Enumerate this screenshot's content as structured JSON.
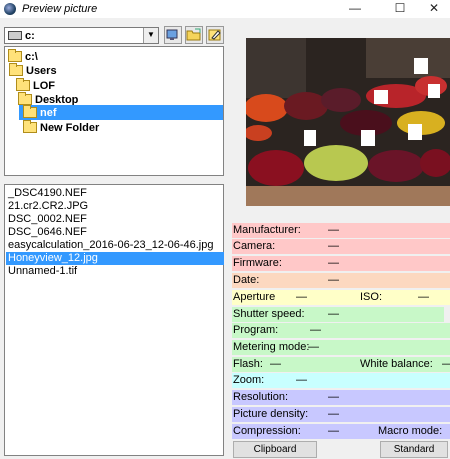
{
  "window": {
    "title": "Preview picture",
    "minimize": "—",
    "maximize": "☐",
    "close": "✕"
  },
  "drive": {
    "value": "c:"
  },
  "folders": [
    {
      "label": "c:\\"
    },
    {
      "label": "Users"
    },
    {
      "label": "LOF"
    },
    {
      "label": "Desktop"
    },
    {
      "label": "nef"
    },
    {
      "label": "New Folder"
    }
  ],
  "files": [
    {
      "name": "_DSC4190.NEF"
    },
    {
      "name": "21.cr2.CR2.JPG"
    },
    {
      "name": "DSC_0002.NEF"
    },
    {
      "name": "DSC_0646.NEF"
    },
    {
      "name": "easycalculation_2016-06-23_12-06-46.jpg"
    },
    {
      "name": "Honeyview_12.jpg"
    },
    {
      "name": "Unnamed-1.tif"
    }
  ],
  "info": {
    "manufacturer": {
      "label": "Manufacturer:",
      "value": "—"
    },
    "camera": {
      "label": "Camera:",
      "value": "—"
    },
    "firmware": {
      "label": "Firmware:",
      "value": "—"
    },
    "date": {
      "label": "Date:",
      "value": "—"
    },
    "aperture": {
      "label": "Aperture",
      "value": "—"
    },
    "iso": {
      "label": "ISO:",
      "value": "—"
    },
    "shutter": {
      "label": "Shutter speed:",
      "value": "—"
    },
    "program": {
      "label": "Program:",
      "value": "—"
    },
    "metering": {
      "label": "Metering mode:",
      "value": "—"
    },
    "flash": {
      "label": "Flash:",
      "value": "—"
    },
    "white_balance": {
      "label": "White balance:",
      "value": "—"
    },
    "zoom": {
      "label": "Zoom:",
      "value": "—"
    },
    "resolution": {
      "label": "Resolution:",
      "value": "—"
    },
    "density": {
      "label": "Picture density:",
      "value": "—"
    },
    "compression": {
      "label": "Compression:",
      "value": "—"
    },
    "macro": {
      "label": "Macro mode:",
      "value": ""
    }
  },
  "buttons": {
    "clipboard": "Clipboard",
    "standard": "Standard"
  },
  "colors": {
    "red": "#ffc8c8",
    "orange": "#fcd8c0",
    "yellow": "#ffffc8",
    "green": "#c8f8c8",
    "cyan": "#c8ffff",
    "blue": "#c8c8ff",
    "selection": "#3399ff"
  }
}
